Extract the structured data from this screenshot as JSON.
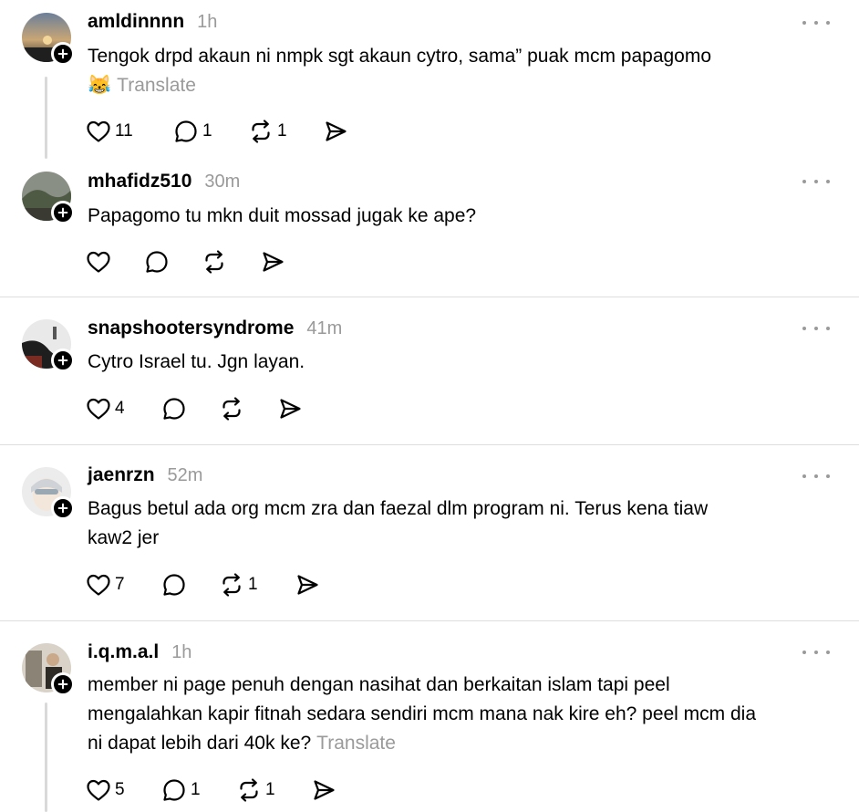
{
  "posts": [
    {
      "username": "amldinnnn",
      "time": "1h",
      "text": "Tengok drpd akaun ni nmpk sgt akaun cytro, sama” puak mcm papagomo",
      "emoji": "😹",
      "translate": "Translate",
      "likes": "11",
      "replies": "1",
      "reposts": "1"
    },
    {
      "username": "mhafidz510",
      "time": "30m",
      "text": "Papagomo tu mkn duit mossad jugak ke ape?",
      "likes": "",
      "replies": "",
      "reposts": ""
    },
    {
      "username": "snapshootersyndrome",
      "time": "41m",
      "text": "Cytro Israel tu. Jgn layan.",
      "likes": "4",
      "replies": "",
      "reposts": ""
    },
    {
      "username": "jaenrzn",
      "time": "52m",
      "text_line1": "Bagus betul ada org mcm zra dan faezal dlm program ni. Terus kena tiaw",
      "text_line2": "kaw2 jer",
      "likes": "7",
      "replies": "",
      "reposts": "1"
    },
    {
      "username": "i.q.m.a.l",
      "time": "1h",
      "text_line1": "member ni page penuh dengan nasihat dan berkaitan islam tapi peel",
      "text_line2": "mengalahkan kapir fitnah sedara sendiri mcm mana nak kire eh? peel mcm dia",
      "text_line3": "ni dapat lebih dari 40k ke?",
      "translate": "Translate",
      "likes": "5",
      "replies": "1",
      "reposts": "1"
    }
  ],
  "icons": {
    "like": "heart-icon",
    "reply": "comment-icon",
    "repost": "repost-icon",
    "share": "send-icon",
    "more": "more-icon",
    "follow": "plus-icon"
  },
  "colors": {
    "text": "#000000",
    "muted": "#9a9a9a",
    "divider": "#dedede",
    "thread_line": "#d9d9d9"
  }
}
